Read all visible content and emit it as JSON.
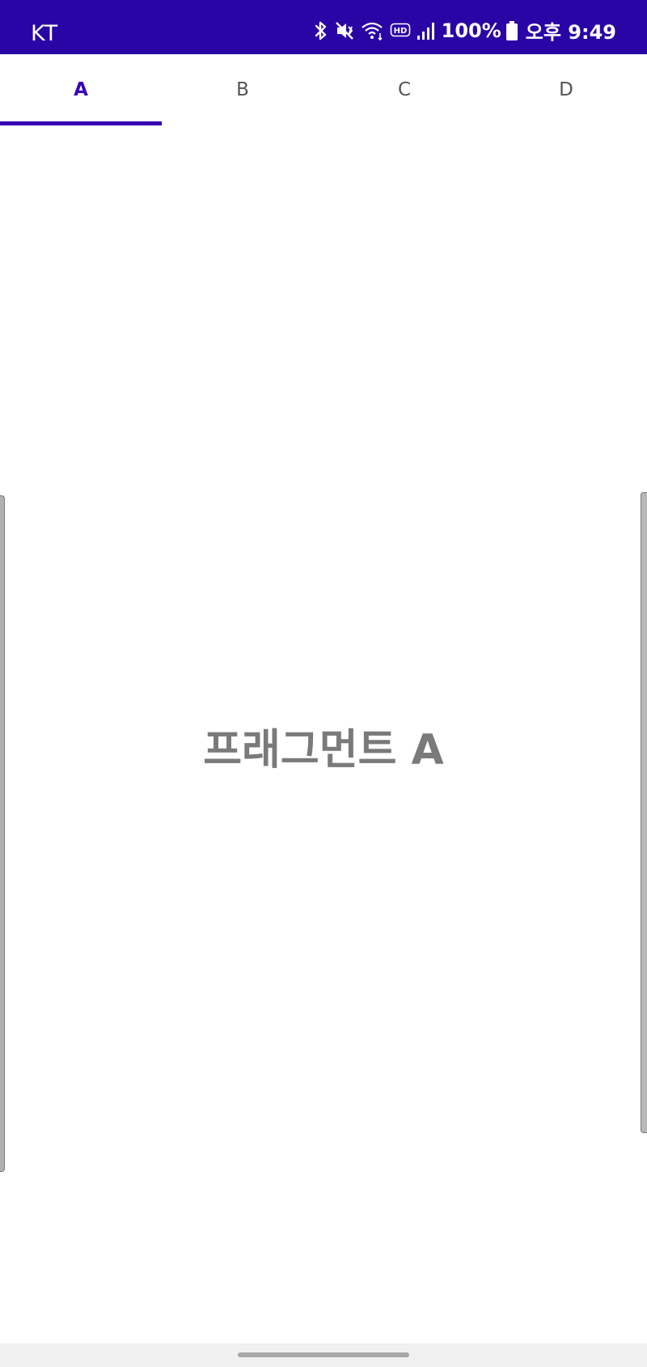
{
  "status_bar": {
    "carrier": "KT",
    "battery": "100%",
    "time": "오후 9:49",
    "background_color": "#2a05a6",
    "icons": [
      "bluetooth-icon",
      "mute-icon",
      "wifi-icon",
      "hd-icon",
      "signal-icon",
      "battery-icon"
    ]
  },
  "tabs": [
    {
      "label": "A",
      "selected": true
    },
    {
      "label": "B",
      "selected": false
    },
    {
      "label": "C",
      "selected": false
    },
    {
      "label": "D",
      "selected": false
    }
  ],
  "accent_color": "#3700b3",
  "content": {
    "label": "프래그먼트 A"
  }
}
